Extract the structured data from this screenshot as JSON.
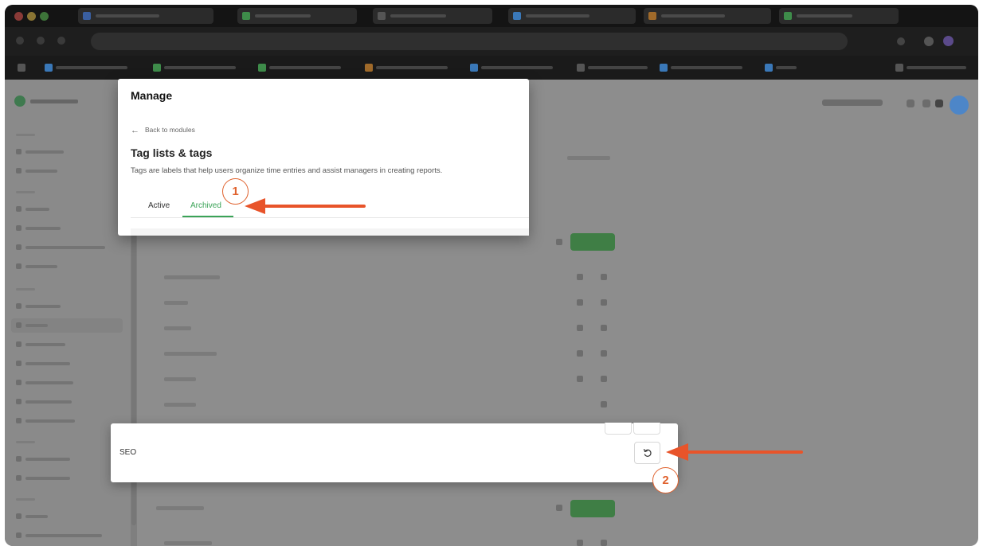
{
  "modal": {
    "title": "Manage",
    "back_label": "Back to modules",
    "back_arrow": "←",
    "section_title": "Tag lists & tags",
    "section_description": "Tags are labels that help users organize time entries and assist managers in creating reports.",
    "tabs": [
      {
        "label": "Active",
        "selected": false
      },
      {
        "label": "Archived",
        "selected": true
      }
    ]
  },
  "archived_item": {
    "name": "SEO",
    "action_icon": "restore-icon"
  },
  "annotations": [
    {
      "number": "1"
    },
    {
      "number": "2"
    }
  ],
  "colors": {
    "accent_green": "#3aa357",
    "annotation_orange": "#e0622e",
    "dim_overlay": "#8d8d8d"
  }
}
